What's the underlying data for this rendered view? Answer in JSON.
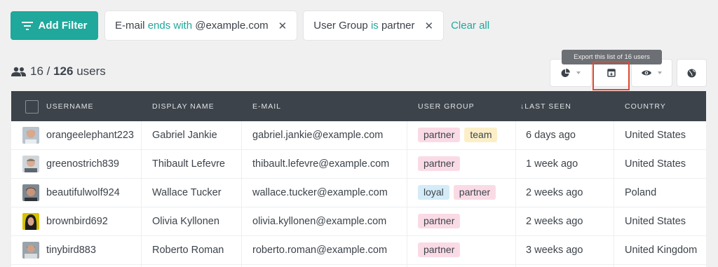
{
  "filter_bar": {
    "add_filter_label": "Add Filter",
    "filters": [
      {
        "field": "E-mail",
        "operator": "ends with",
        "value": "@example.com"
      },
      {
        "field": "User Group",
        "operator": "is",
        "value": "partner"
      }
    ],
    "remove_icon": "✕",
    "clear_all_label": "Clear all"
  },
  "counter": {
    "filtered": "16",
    "separator": " / ",
    "total": "126",
    "unit": " users"
  },
  "toolbar": {
    "tooltip": "Export this list of 16 users",
    "buttons": [
      "pie-chart-icon",
      "export-icon",
      "eye-icon",
      "globe-icon"
    ]
  },
  "table": {
    "columns": [
      "USERNAME",
      "DISPLAY NAME",
      "E-MAIL",
      "USER GROUP",
      "↓LAST SEEN",
      "COUNTRY"
    ],
    "rows": [
      {
        "username": "orangeelephant223",
        "display_name": "Gabriel Jankie",
        "email": "gabriel.jankie@example.com",
        "groups": [
          "partner",
          "team"
        ],
        "last_seen": "6 days ago",
        "country": "United States"
      },
      {
        "username": "greenostrich839",
        "display_name": "Thibault Lefevre",
        "email": "thibault.lefevre@example.com",
        "groups": [
          "partner"
        ],
        "last_seen": "1 week ago",
        "country": "United States"
      },
      {
        "username": "beautifulwolf924",
        "display_name": "Wallace Tucker",
        "email": "wallace.tucker@example.com",
        "groups": [
          "loyal",
          "partner"
        ],
        "last_seen": "2 weeks ago",
        "country": "Poland"
      },
      {
        "username": "brownbird692",
        "display_name": "Olivia Kyllonen",
        "email": "olivia.kyllonen@example.com",
        "groups": [
          "partner"
        ],
        "last_seen": "2 weeks ago",
        "country": "United States"
      },
      {
        "username": "tinybird883",
        "display_name": "Roberto Roman",
        "email": "roberto.roman@example.com",
        "groups": [
          "partner"
        ],
        "last_seen": "3 weeks ago",
        "country": "United Kingdom"
      }
    ]
  },
  "colors": {
    "accent": "#1fa89b",
    "header_bg": "#3c434a",
    "highlight": "#e04a2f"
  }
}
